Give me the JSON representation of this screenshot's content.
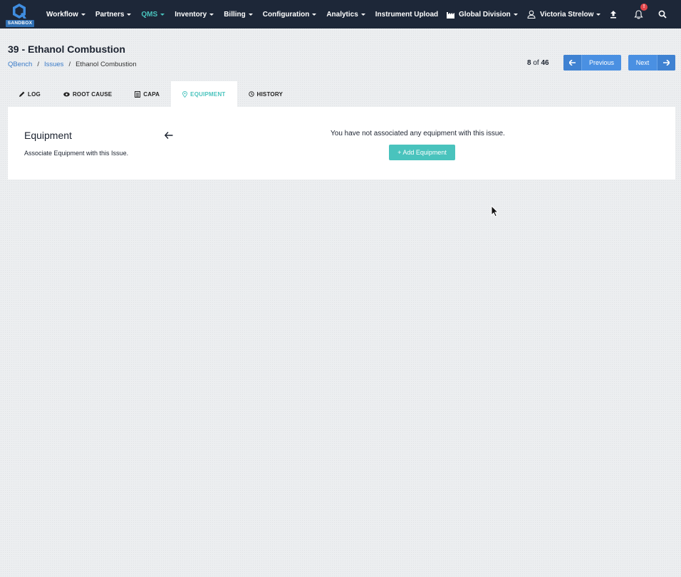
{
  "app": {
    "logo_badge": "SANDBOX",
    "brand_color": "#2f6fb3",
    "accent_color": "#49c3bd",
    "primary_button_color": "#4a90e2"
  },
  "nav": {
    "items": [
      {
        "label": "Workflow",
        "dropdown": true,
        "active": false
      },
      {
        "label": "Partners",
        "dropdown": true,
        "active": false
      },
      {
        "label": "QMS",
        "dropdown": true,
        "active": true
      },
      {
        "label": "Inventory",
        "dropdown": true,
        "active": false
      },
      {
        "label": "Billing",
        "dropdown": true,
        "active": false
      },
      {
        "label": "Configuration",
        "dropdown": true,
        "active": false
      },
      {
        "label": "Analytics",
        "dropdown": true,
        "active": false
      },
      {
        "label": "Instrument Upload",
        "dropdown": false,
        "active": false
      }
    ],
    "division": "Global Division",
    "user": "Victoria Strelow",
    "notification_badge": "!",
    "icons": [
      "factory-icon",
      "user-icon",
      "upload-icon",
      "bell-icon",
      "search-icon"
    ]
  },
  "header": {
    "title": "39 - Ethanol Combustion",
    "breadcrumb": [
      "QBench",
      "Issues",
      "Ethanol Combustion"
    ],
    "pager_current": "8",
    "pager_of": "of",
    "pager_total": "46",
    "prev_label": "Previous",
    "next_label": "Next"
  },
  "tabs": [
    {
      "label": "LOG",
      "icon": "pencil-icon",
      "active": false
    },
    {
      "label": "ROOT CAUSE",
      "icon": "eye-icon",
      "active": false
    },
    {
      "label": "CAPA",
      "icon": "clipboard-icon",
      "active": false
    },
    {
      "label": "EQUIPMENT",
      "icon": "location-pin-icon",
      "active": true
    },
    {
      "label": "HISTORY",
      "icon": "history-icon",
      "active": false
    }
  ],
  "equipment": {
    "title": "Equipment",
    "description": "Associate Equipment with this Issue.",
    "empty_message": "You have not associated any equipment with this issue.",
    "add_button": "+ Add Equipment"
  }
}
